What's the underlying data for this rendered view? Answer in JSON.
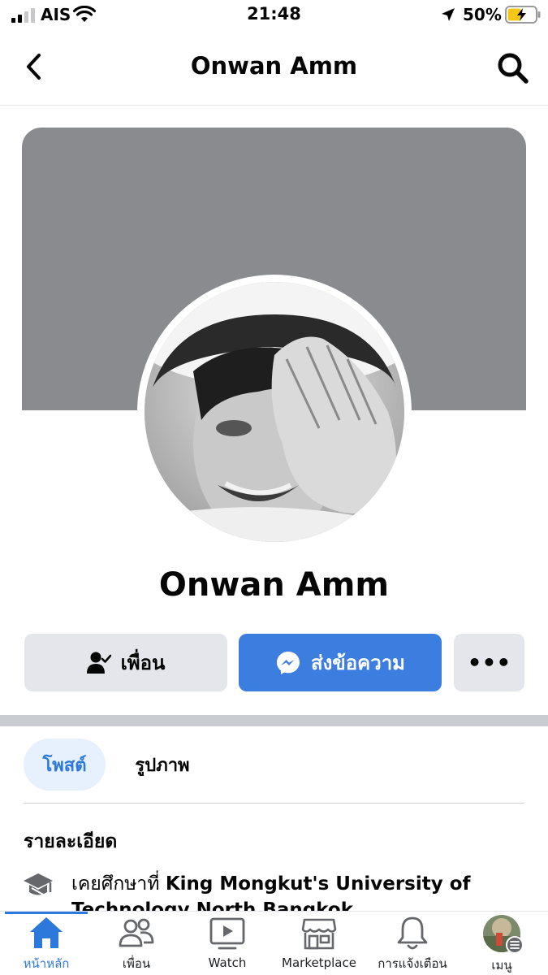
{
  "status_bar": {
    "carrier": "AIS",
    "time": "21:48",
    "battery_percent": "50%",
    "battery_level": 0.5,
    "icons": [
      "signal-icon",
      "wifi-icon",
      "location-arrow-icon",
      "battery-charging-icon"
    ]
  },
  "header": {
    "title": "Onwan Amm",
    "back_icon": "chevron-left-icon",
    "search_icon": "search-icon"
  },
  "profile": {
    "name": "Onwan Amm",
    "cover_color": "#898b8e"
  },
  "actions": {
    "friend_label": "เพื่อน",
    "message_label": "ส่งข้อความ",
    "more_label": "•••",
    "message_color": "#3c7de0"
  },
  "tabs": [
    {
      "label": "โพสต์",
      "active": true
    },
    {
      "label": "รูปภาพ",
      "active": false
    }
  ],
  "details": {
    "heading": "รายละเอียด",
    "education_prefix": "เคยศึกษาที่ ",
    "education_school": "King Mongkut's University of Technology North Bangkok"
  },
  "bottom_nav": {
    "active_color": "#2d78db",
    "items": [
      {
        "label": "หน้าหลัก",
        "icon": "home-icon",
        "active": true
      },
      {
        "label": "เพื่อน",
        "icon": "friends-icon",
        "active": false
      },
      {
        "label": "Watch",
        "icon": "watch-icon",
        "active": false
      },
      {
        "label": "Marketplace",
        "icon": "marketplace-icon",
        "active": false
      },
      {
        "label": "การแจ้งเตือน",
        "icon": "bell-icon",
        "active": false
      },
      {
        "label": "เมนู",
        "icon": "menu-avatar-icon",
        "active": false
      }
    ]
  }
}
